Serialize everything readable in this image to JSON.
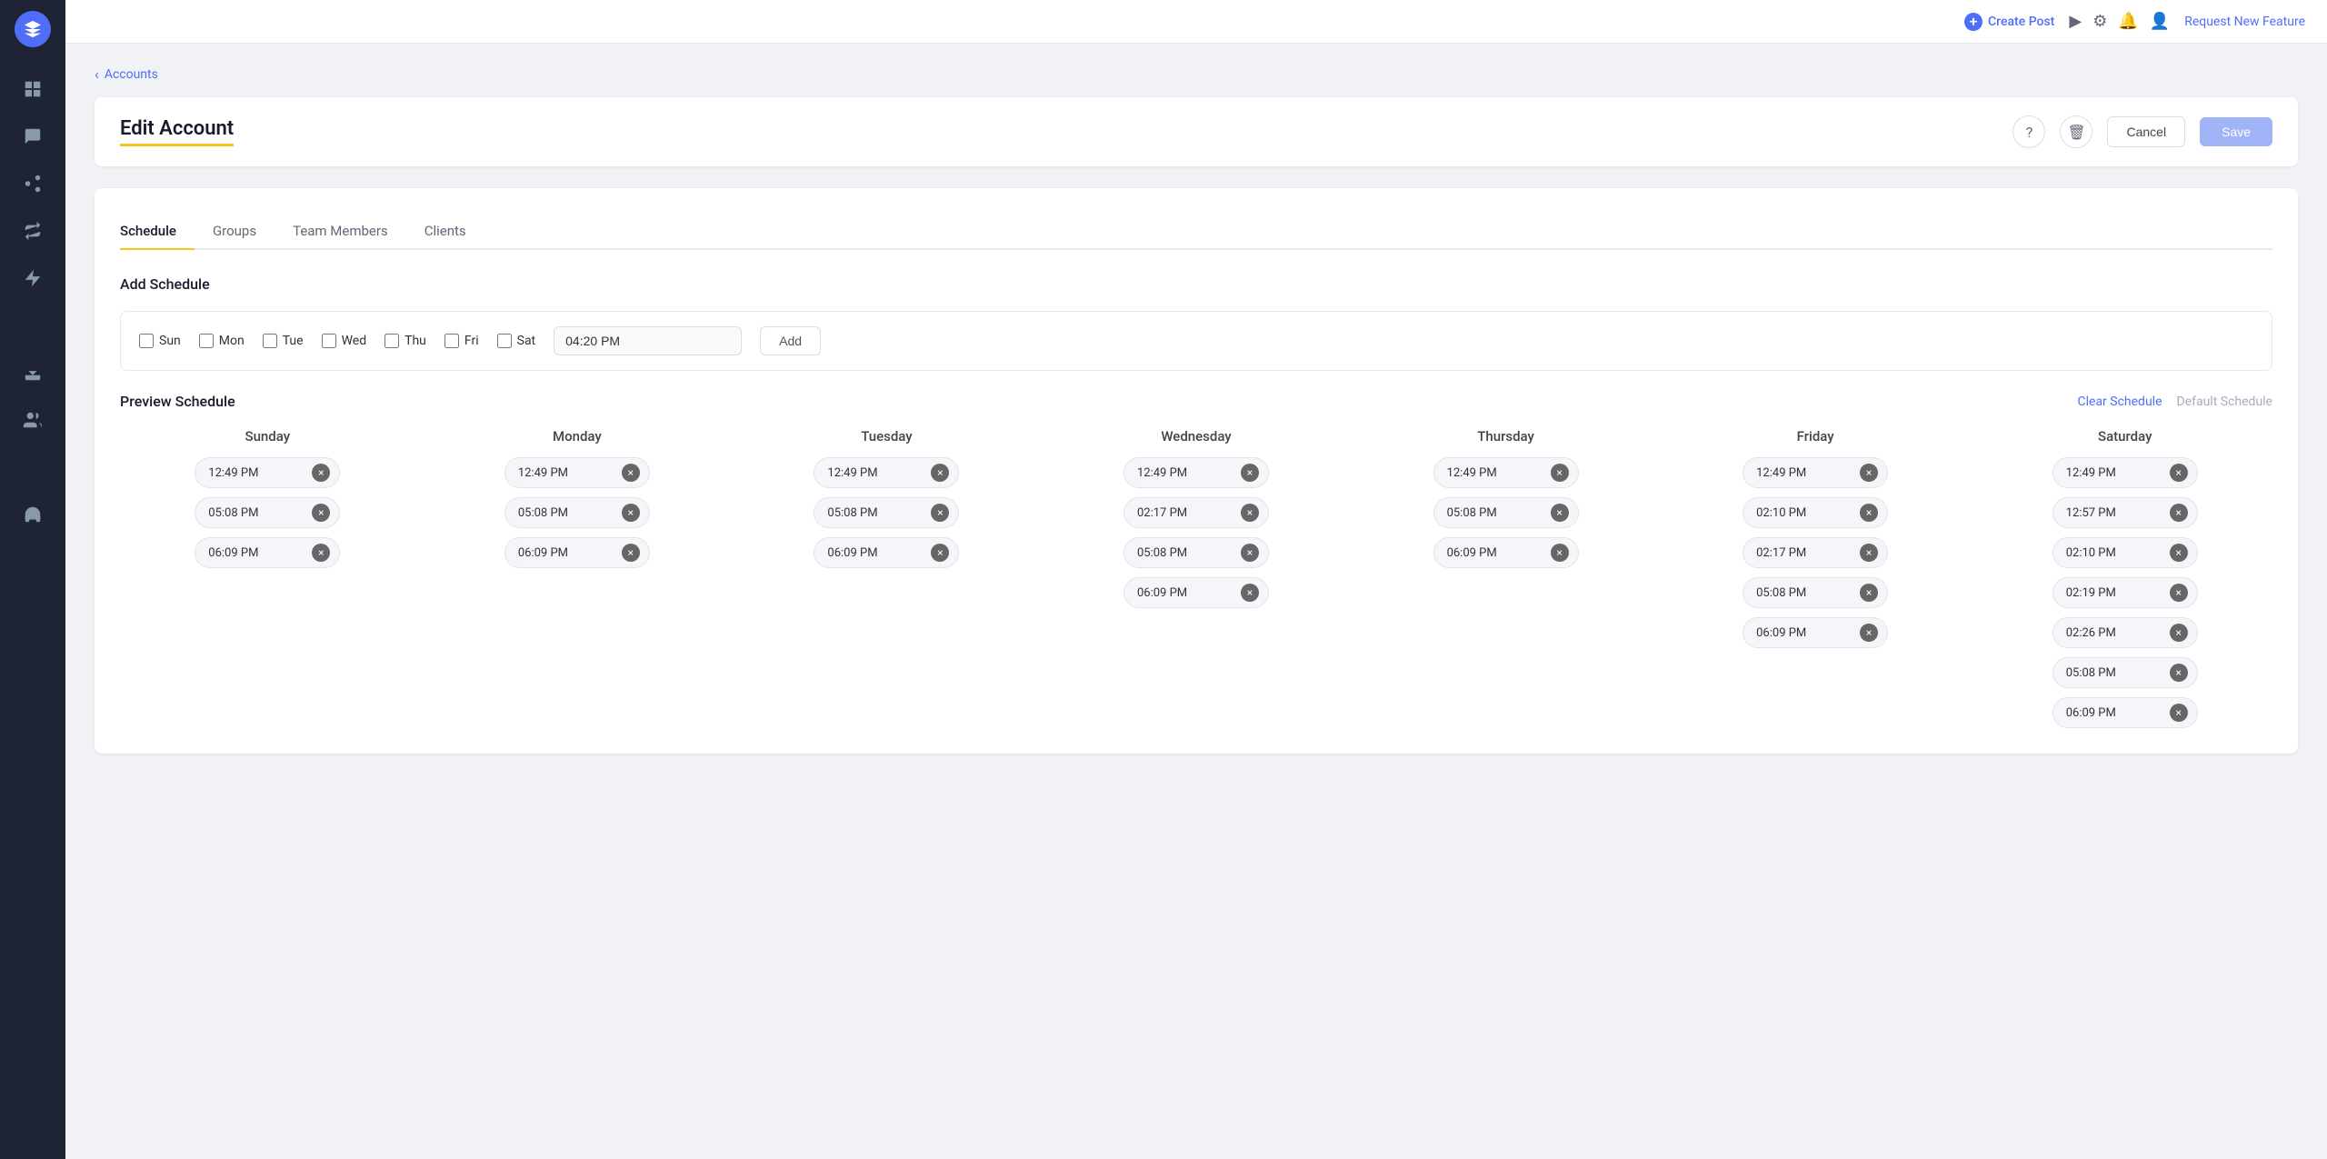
{
  "topbar": {
    "create_post_label": "Create Post",
    "request_feature_label": "Request New Feature"
  },
  "breadcrumb": {
    "label": "Accounts"
  },
  "page": {
    "title": "Edit Account",
    "cancel_label": "Cancel",
    "save_label": "Save"
  },
  "tabs": [
    {
      "id": "schedule",
      "label": "Schedule",
      "active": true
    },
    {
      "id": "groups",
      "label": "Groups",
      "active": false
    },
    {
      "id": "team-members",
      "label": "Team Members",
      "active": false
    },
    {
      "id": "clients",
      "label": "Clients",
      "active": false
    }
  ],
  "schedule_form": {
    "title": "Add Schedule",
    "days": [
      {
        "id": "sun",
        "label": "Sun",
        "checked": false
      },
      {
        "id": "mon",
        "label": "Mon",
        "checked": false
      },
      {
        "id": "tue",
        "label": "Tue",
        "checked": false
      },
      {
        "id": "wed",
        "label": "Wed",
        "checked": false
      },
      {
        "id": "thu",
        "label": "Thu",
        "checked": false
      },
      {
        "id": "fri",
        "label": "Fri",
        "checked": false
      },
      {
        "id": "sat",
        "label": "Sat",
        "checked": false
      }
    ],
    "time_value": "04:20 PM",
    "add_label": "Add"
  },
  "preview": {
    "title": "Preview Schedule",
    "clear_label": "Clear Schedule",
    "default_label": "Default Schedule",
    "days": [
      {
        "label": "Sunday",
        "times": [
          "12:49 PM",
          "05:08 PM",
          "06:09 PM"
        ]
      },
      {
        "label": "Monday",
        "times": [
          "12:49 PM",
          "05:08 PM",
          "06:09 PM"
        ]
      },
      {
        "label": "Tuesday",
        "times": [
          "12:49 PM",
          "05:08 PM",
          "06:09 PM"
        ]
      },
      {
        "label": "Wednesday",
        "times": [
          "12:49 PM",
          "02:17 PM",
          "05:08 PM",
          "06:09 PM"
        ]
      },
      {
        "label": "Thursday",
        "times": [
          "12:49 PM",
          "05:08 PM",
          "06:09 PM"
        ]
      },
      {
        "label": "Friday",
        "times": [
          "12:49 PM",
          "02:10 PM",
          "02:17 PM",
          "05:08 PM",
          "06:09 PM"
        ]
      },
      {
        "label": "Saturday",
        "times": [
          "12:49 PM",
          "12:57 PM",
          "02:10 PM",
          "02:19 PM",
          "02:26 PM",
          "05:08 PM",
          "06:09 PM"
        ]
      }
    ]
  },
  "sidebar": {
    "items": [
      {
        "id": "dashboard",
        "icon": "grid"
      },
      {
        "id": "messages",
        "icon": "chat"
      },
      {
        "id": "network",
        "icon": "share"
      },
      {
        "id": "loop",
        "icon": "loop"
      },
      {
        "id": "megaphone",
        "icon": "megaphone"
      },
      {
        "id": "analytics",
        "icon": "bar-chart"
      },
      {
        "id": "download",
        "icon": "download"
      },
      {
        "id": "team",
        "icon": "team"
      },
      {
        "id": "list",
        "icon": "list"
      },
      {
        "id": "support",
        "icon": "headset"
      }
    ]
  }
}
